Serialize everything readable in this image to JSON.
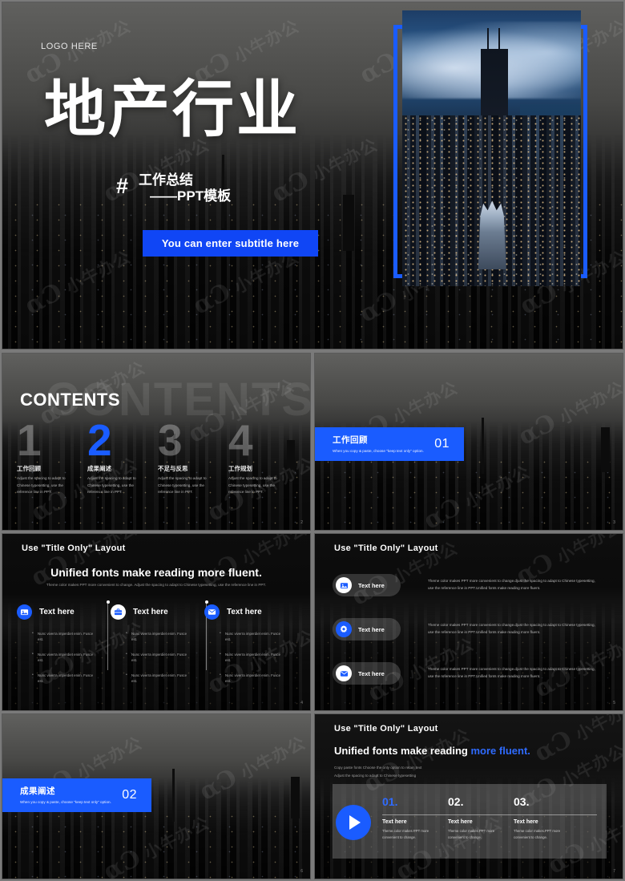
{
  "brand": {
    "accent_blue": "#1a5cff",
    "button_blue": "#1046f5",
    "dark_bg": "#121212"
  },
  "watermark": {
    "logo": "αƆ",
    "text": "小牛办公"
  },
  "cover": {
    "logo": "LOGO HERE",
    "title": "地产行业",
    "hash": "#",
    "subtitle_line1": "工作总结",
    "subtitle_line2": "——PPT模板",
    "button": "You can enter subtitle here",
    "photo_alt": "night-cityscape-skyscrapers"
  },
  "contents": {
    "ghost": "CONTENTS",
    "title": "CONTENTS",
    "page": "2",
    "items": [
      {
        "num": "1",
        "heading": "工作回顾",
        "desc": "Adjust the spacing to adapt to Chinese typesetting, use the reference line in PPT.",
        "active": false
      },
      {
        "num": "2",
        "heading": "成果阐述",
        "desc": "Adjust the spacing to adapt to Chinese typesetting, use the reference line in PPT.",
        "active": true
      },
      {
        "num": "3",
        "heading": "不足与反思",
        "desc": "Adjust the spacing to adapt to Chinese typesetting, use the reference line in PPT.",
        "active": false
      },
      {
        "num": "4",
        "heading": "工作规划",
        "desc": "Adjust the spacing to adapt to Chinese typesetting, use the reference line in PPT.",
        "active": false
      }
    ]
  },
  "section1": {
    "cn": "工作回顾",
    "en": "When you copy & paste, choose \"keep text only\" option.",
    "number": "01",
    "page": "3"
  },
  "section2": {
    "cn": "成果阐述",
    "en": "When you copy & paste, choose \"keep text only\" option.",
    "number": "02",
    "page": "6"
  },
  "columns_slide": {
    "title": "Use \"Title Only\" Layout",
    "headline": "Unified fonts make reading more fluent.",
    "subline": "Theme color makes PPT more convenient to change. Adjust the spacing to adapt to Chinese typesetting, use the reference line in PPT.",
    "page": "4",
    "columns": [
      {
        "icon": "image-icon",
        "icon_style": "blue",
        "label": "Text here",
        "bullets": [
          "Nunc viverra imperdiet enim. Fusce est.",
          "Nunc viverra imperdiet enim. Fusce est.",
          "Nunc viverra imperdiet enim. Fusce est."
        ]
      },
      {
        "icon": "briefcase-icon",
        "icon_style": "white",
        "label": "Text here",
        "bullets": [
          "Nunc viverra imperdiet enim. Fusce est.",
          "Nunc viverra imperdiet enim. Fusce est.",
          "Nunc viverra imperdiet enim. Fusce est."
        ]
      },
      {
        "icon": "envelope-icon",
        "icon_style": "blue",
        "label": "Text here",
        "bullets": [
          "Nunc viverra imperdiet enim. Fusce est.",
          "Nunc viverra imperdiet enim. Fusce est.",
          "Nunc viverra imperdiet enim. Fusce est."
        ]
      }
    ]
  },
  "pills_slide": {
    "title": "Use \"Title Only\" Layout",
    "page": "5",
    "rows": [
      {
        "icon": "image-icon",
        "icon_style": "white",
        "label": "Text here",
        "text": "Theme color makes PPT more convenient to change.djust the spacing to adapt to Chinese typesetting, use the reference line in PPT.Unified fonts make reading more fluent."
      },
      {
        "icon": "gear-icon",
        "icon_style": "blue",
        "label": "Text here",
        "text": "Theme color makes PPT more convenient to change.djust the spacing to adapt to Chinese typesetting, use the reference line in PPT.Unified fonts make reading more fluent."
      },
      {
        "icon": "envelope-icon",
        "icon_style": "white",
        "label": "Text here",
        "text": "Theme color makes PPT more convenient to change.djust the spacing to adapt to Chinese typesetting, use the reference line in PPT.Unified fonts make reading more fluent."
      }
    ]
  },
  "numbers_slide": {
    "title": "Use \"Title Only\" Layout",
    "headline_plain": "Unified fonts make reading ",
    "headline_highlight": "more fluent.",
    "sub_line1": "Copy paste fonts Choose the only option to retain text",
    "sub_line2": "Adjust the spacing to adapt to Chinese typesetting",
    "play_icon": "play-icon",
    "page": "7",
    "items": [
      {
        "num": "01.",
        "label": "Text here",
        "desc": "Theme color makes PPT more convenient to change."
      },
      {
        "num": "02.",
        "label": "Text here",
        "desc": "Theme color makes PPT more convenient to change."
      },
      {
        "num": "03.",
        "label": "Text here",
        "desc": "Theme color makes PPT more convenient to change."
      }
    ]
  }
}
